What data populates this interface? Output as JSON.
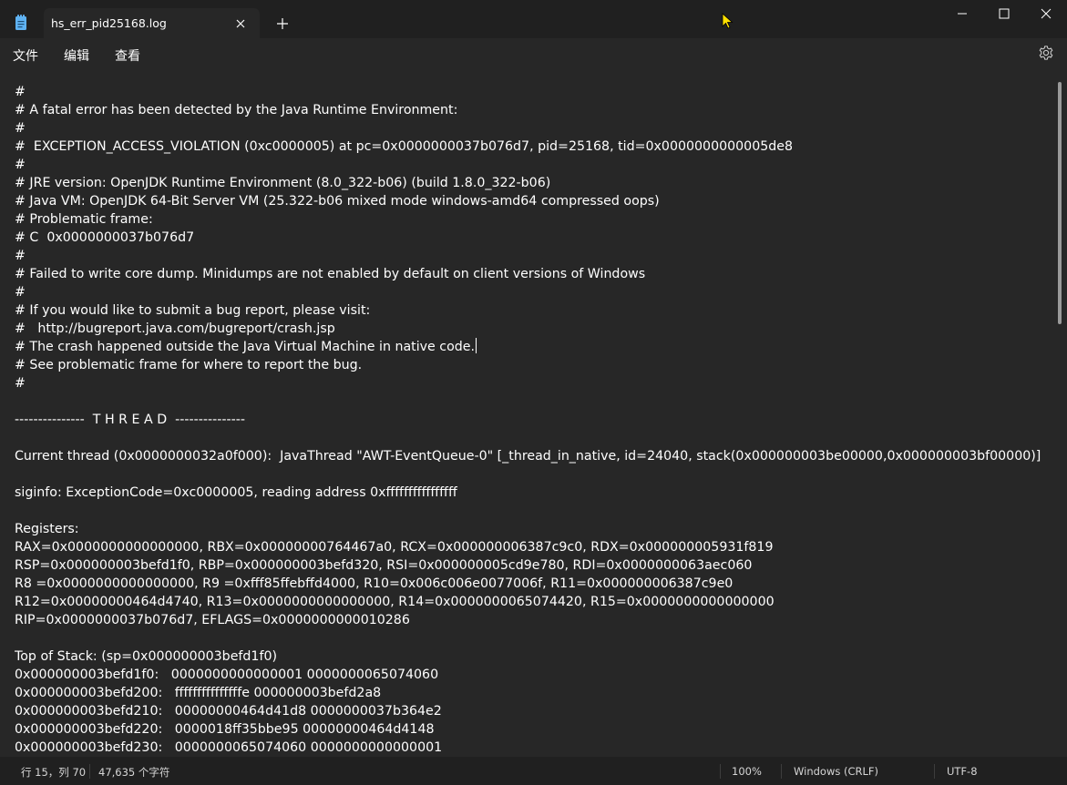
{
  "window": {
    "tab_title": "hs_err_pid25168.log",
    "app_icon": "notepad-icon",
    "new_tab_icon": "plus-icon",
    "close_tab_icon": "close-icon",
    "controls": [
      "minimize-icon",
      "maximize-icon",
      "close-icon"
    ]
  },
  "menu": {
    "file": "文件",
    "edit": "编辑",
    "view": "查看",
    "settings_icon": "gear-icon"
  },
  "editor": {
    "lines": [
      "#",
      "# A fatal error has been detected by the Java Runtime Environment:",
      "#",
      "#  EXCEPTION_ACCESS_VIOLATION (0xc0000005) at pc=0x0000000037b076d7, pid=25168, tid=0x0000000000005de8",
      "#",
      "# JRE version: OpenJDK Runtime Environment (8.0_322-b06) (build 1.8.0_322-b06)",
      "# Java VM: OpenJDK 64-Bit Server VM (25.322-b06 mixed mode windows-amd64 compressed oops)",
      "# Problematic frame:",
      "# C  0x0000000037b076d7",
      "#",
      "# Failed to write core dump. Minidumps are not enabled by default on client versions of Windows",
      "#",
      "# If you would like to submit a bug report, please visit:",
      "#   http://bugreport.java.com/bugreport/crash.jsp",
      "# The crash happened outside the Java Virtual Machine in native code.",
      "# See problematic frame for where to report the bug.",
      "#",
      "",
      "---------------  T H R E A D  ---------------",
      "",
      "Current thread (0x0000000032a0f000):  JavaThread \"AWT-EventQueue-0\" [_thread_in_native, id=24040, stack(0x000000003be00000,0x000000003bf00000)]",
      "",
      "siginfo: ExceptionCode=0xc0000005, reading address 0xffffffffffffffff",
      "",
      "Registers:",
      "RAX=0x0000000000000000, RBX=0x00000000764467a0, RCX=0x000000006387c9c0, RDX=0x000000005931f819",
      "RSP=0x000000003befd1f0, RBP=0x000000003befd320, RSI=0x000000005cd9e780, RDI=0x0000000063aec060",
      "R8 =0x0000000000000000, R9 =0xfff85ffebffd4000, R10=0x006c006e0077006f, R11=0x000000006387c9e0",
      "R12=0x00000000464d4740, R13=0x0000000000000000, R14=0x0000000065074420, R15=0x0000000000000000",
      "RIP=0x0000000037b076d7, EFLAGS=0x0000000000010286",
      "",
      "Top of Stack: (sp=0x000000003befd1f0)",
      "0x000000003befd1f0:   0000000000000001 0000000065074060",
      "0x000000003befd200:   fffffffffffffffe 000000003befd2a8",
      "0x000000003befd210:   00000000464d41d8 0000000037b364e2",
      "0x000000003befd220:   0000018ff35bbe95 00000000464d4148",
      "0x000000003befd230:   0000000065074060 0000000000000001"
    ],
    "caret_line": 15
  },
  "status": {
    "position": "行 15，列 70",
    "char_count": "47,635 个字符",
    "zoom": "100%",
    "line_ending": "Windows (CRLF)",
    "encoding": "UTF-8"
  },
  "colors": {
    "titlebar": "#202020",
    "editor_bg": "#272727",
    "text": "#ffffff",
    "app_icon": "#5fb2f2",
    "cursor": "#ffe000"
  }
}
